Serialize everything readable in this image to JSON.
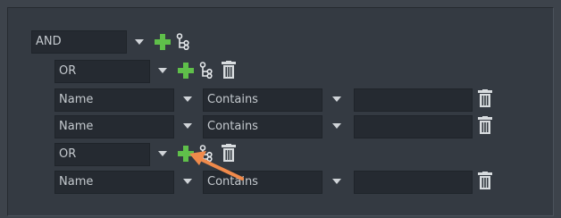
{
  "root": {
    "operator": "AND"
  },
  "groups": [
    {
      "operator": "OR",
      "conditions": [
        {
          "field": "Name",
          "comparison": "Contains",
          "value": ""
        },
        {
          "field": "Name",
          "comparison": "Contains",
          "value": ""
        }
      ]
    },
    {
      "operator": "OR",
      "conditions": [
        {
          "field": "Name",
          "comparison": "Contains",
          "value": ""
        }
      ]
    }
  ],
  "icons": {
    "add": "plus-icon",
    "branch": "add-subgroup-icon",
    "delete": "trash-icon"
  },
  "colors": {
    "accent_green": "#5fbf4a",
    "annotation_arrow": "#f08a4b"
  }
}
